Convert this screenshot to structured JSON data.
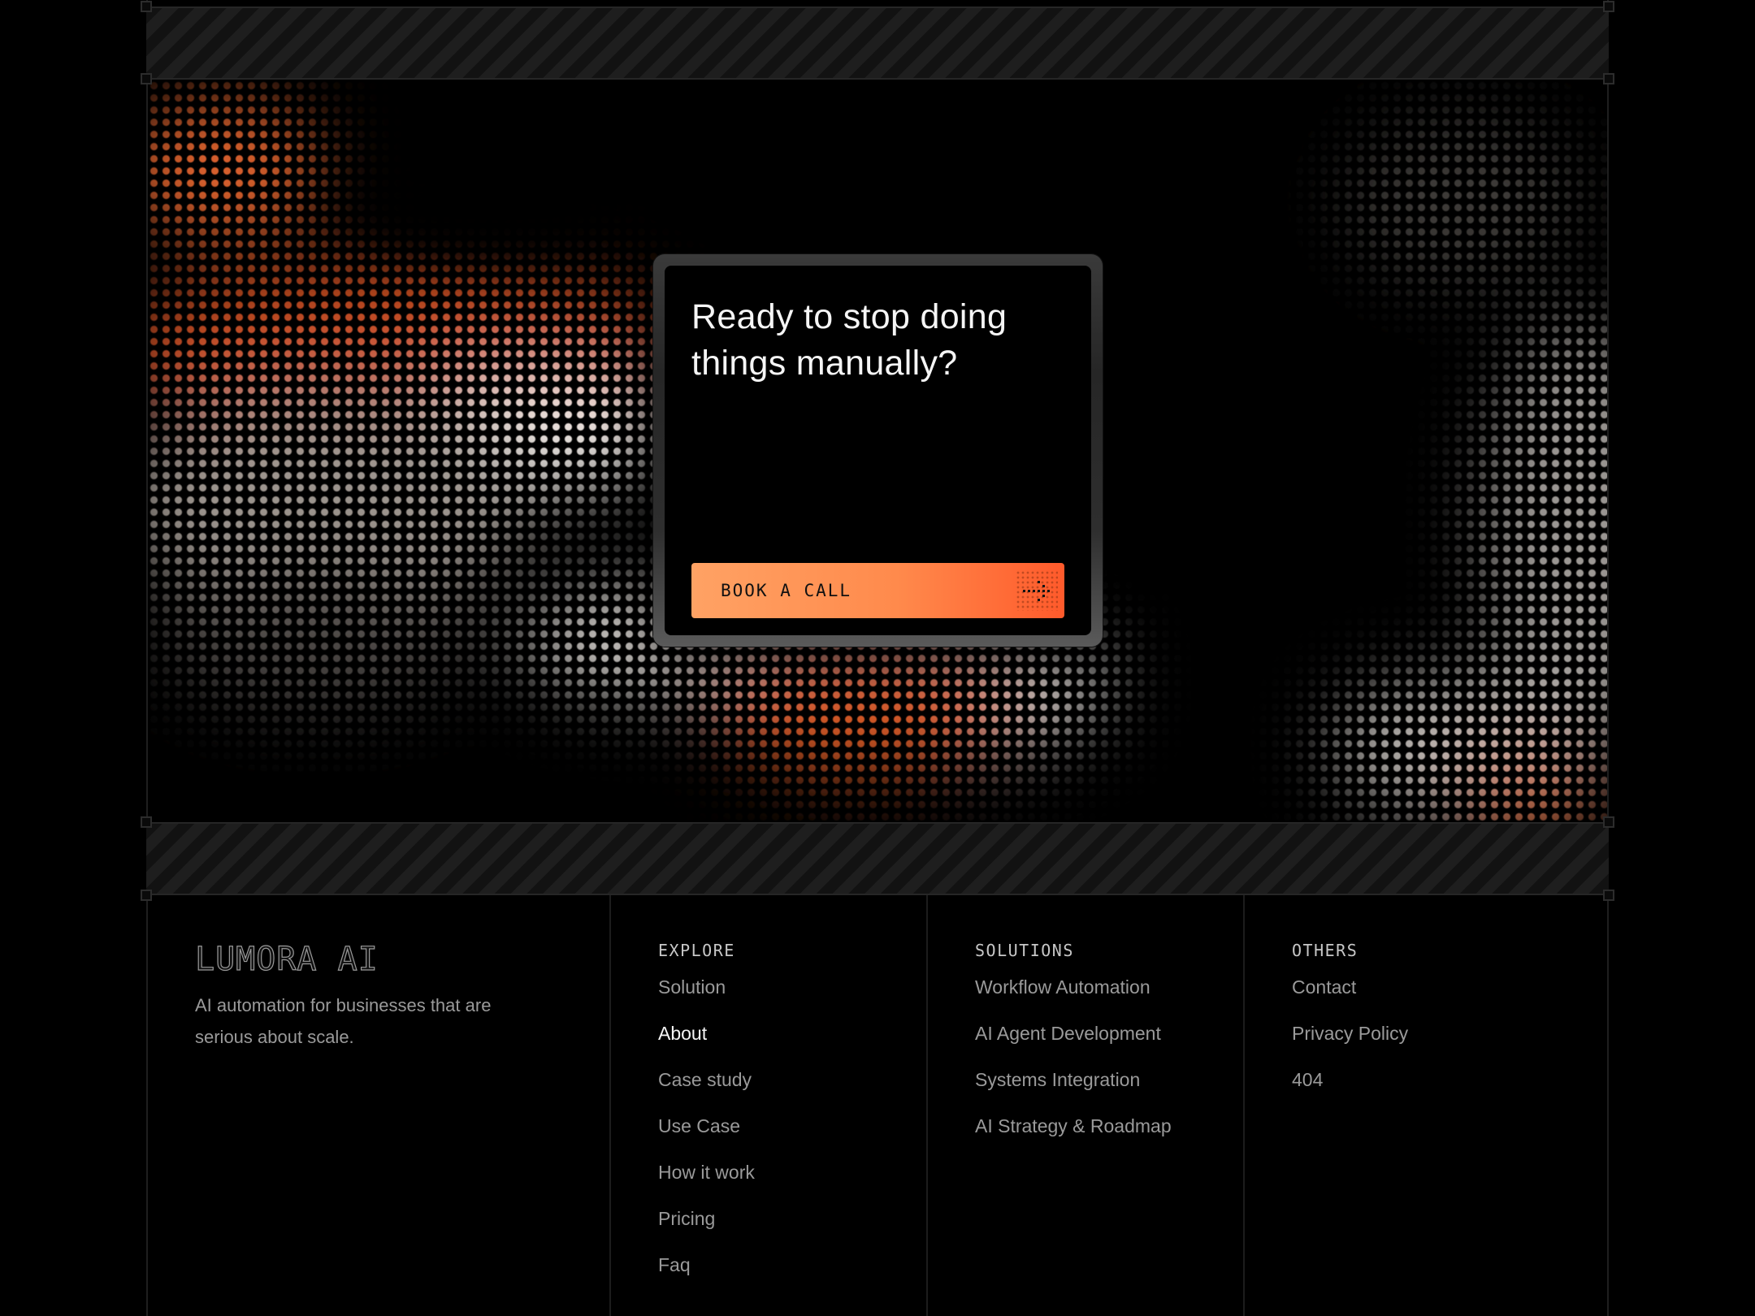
{
  "cta": {
    "title": "Ready to stop doing things manually?",
    "button_label": "BOOK A CALL",
    "button_icon": "arrow-right-icon"
  },
  "footer": {
    "brand": {
      "logo": "LUMORA AI",
      "description": "AI automation for businesses that are serious about scale."
    },
    "explore": {
      "heading": "EXPLORE",
      "links": [
        "Solution",
        "About",
        "Case study",
        "Use Case",
        "How it work",
        "Pricing",
        "Faq"
      ],
      "active": "About"
    },
    "solutions": {
      "heading": "SOLUTIONS",
      "links": [
        "Workflow Automation",
        "AI Agent Development",
        "Systems Integration",
        "AI Strategy & Roadmap"
      ]
    },
    "others": {
      "heading": "OTHERS",
      "links": [
        "Contact",
        "Privacy Policy",
        "404"
      ]
    }
  },
  "colors": {
    "background": "#000000",
    "accent_start": "#ffa264",
    "accent_end": "#ff5a2b",
    "text_primary": "#f5f5f5",
    "text_muted": "#9a9a9a"
  }
}
